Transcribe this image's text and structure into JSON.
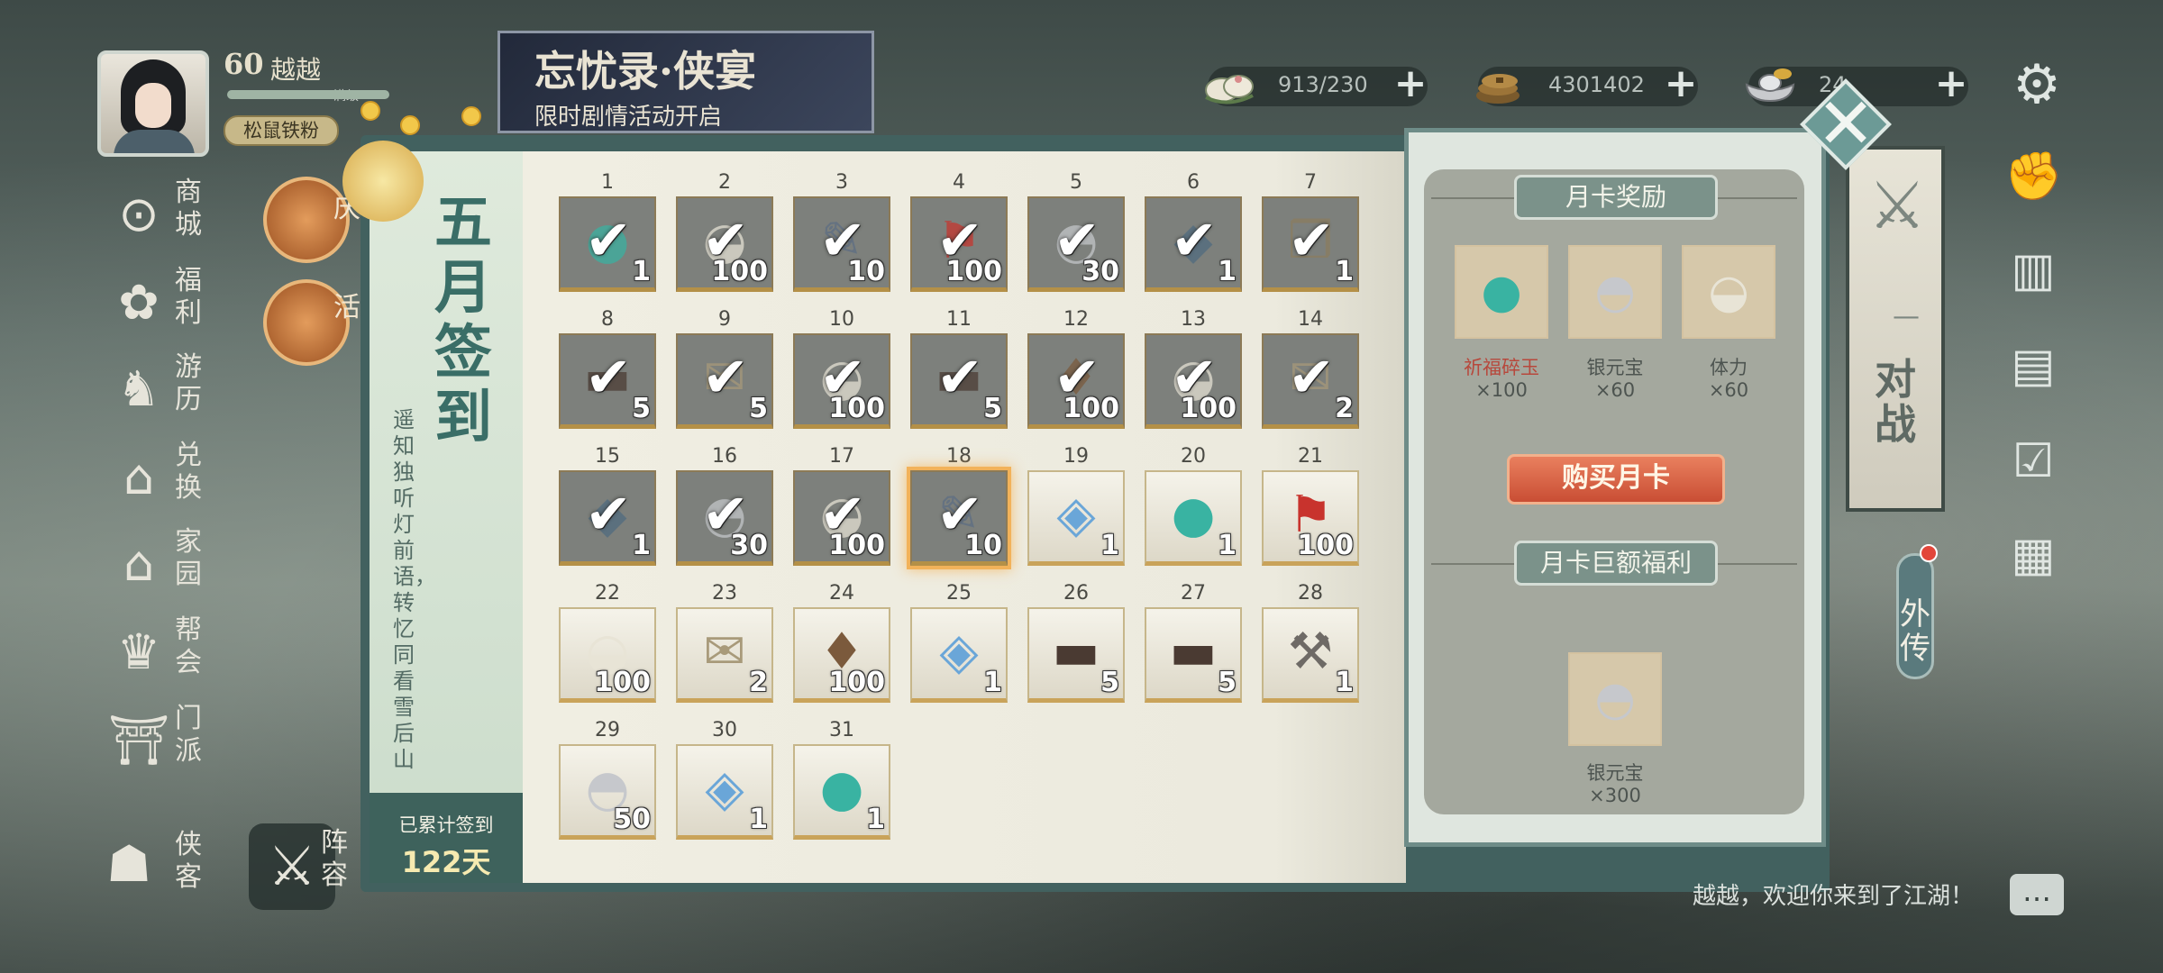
{
  "player": {
    "level": "60",
    "name": "越越",
    "level_caption": "满级",
    "tag": "松鼠铁粉"
  },
  "banner": {
    "title": "忘忧录·侠宴",
    "subtitle": "限时剧情活动开启"
  },
  "resources": [
    {
      "icon": "stamina-bun-icon",
      "value": "913/230",
      "plus": "+"
    },
    {
      "icon": "copper-coins-icon",
      "value": "4301402",
      "plus": "+"
    },
    {
      "icon": "silver-ingot-icon",
      "value": "24",
      "plus": "+"
    }
  ],
  "left_nav": [
    {
      "key": "shop",
      "icon": "coin-shop-icon",
      "glyph": "⊙",
      "label": "商城"
    },
    {
      "key": "welfare",
      "icon": "lotus-icon",
      "glyph": "✿",
      "label": "福利"
    },
    {
      "key": "travel",
      "icon": "horse-icon",
      "glyph": "♞",
      "label": "游历"
    },
    {
      "key": "exchange",
      "icon": "exchange-pavilion-icon",
      "glyph": "⌂",
      "label": "兑换"
    },
    {
      "key": "home",
      "icon": "house-icon",
      "glyph": "⌂",
      "label": "家园"
    },
    {
      "key": "guild",
      "icon": "guild-crest-icon",
      "glyph": "♛",
      "label": "帮会"
    },
    {
      "key": "sect",
      "icon": "sect-gate-icon",
      "glyph": "⛩",
      "label": "门派"
    }
  ],
  "bottom_nav": {
    "hero_label": "侠客",
    "lineup_label": "阵容"
  },
  "side_event_partial": {
    "a": "庆",
    "b": "活"
  },
  "right_nav": [
    "fist-icon",
    "scroll-book-icon",
    "bookshelf-icon",
    "checklist-icon",
    "open-book-icon"
  ],
  "pvp": {
    "label": "对战",
    "divider": "—"
  },
  "outer_story": {
    "label": "外传"
  },
  "signin": {
    "title": "五月签到",
    "poem": "遥知独听灯前语，转忆同看雪后山",
    "total_label": "已累计签到",
    "total_value": "122天",
    "today": 18,
    "days": [
      {
        "day": 1,
        "item": "orb",
        "qty": "1",
        "claimed": true
      },
      {
        "day": 2,
        "item": "bun",
        "qty": "100",
        "claimed": true
      },
      {
        "day": 3,
        "item": "scroll",
        "qty": "10",
        "claimed": true
      },
      {
        "day": 4,
        "item": "banner",
        "qty": "100",
        "claimed": true
      },
      {
        "day": 5,
        "item": "ingot",
        "qty": "30",
        "claimed": true
      },
      {
        "day": 6,
        "item": "stone",
        "qty": "1",
        "claimed": true
      },
      {
        "day": 7,
        "item": "book",
        "qty": "1",
        "claimed": true
      },
      {
        "day": 8,
        "item": "chest",
        "qty": "5",
        "claimed": true
      },
      {
        "day": 9,
        "item": "letters",
        "qty": "5",
        "claimed": true
      },
      {
        "day": 10,
        "item": "bun",
        "qty": "100",
        "claimed": true
      },
      {
        "day": 11,
        "item": "chest",
        "qty": "5",
        "claimed": true
      },
      {
        "day": 12,
        "item": "pouch",
        "qty": "100",
        "claimed": true
      },
      {
        "day": 13,
        "item": "bun",
        "qty": "100",
        "claimed": true
      },
      {
        "day": 14,
        "item": "letters",
        "qty": "2",
        "claimed": true
      },
      {
        "day": 15,
        "item": "stone",
        "qty": "1",
        "claimed": true
      },
      {
        "day": 16,
        "item": "ingot",
        "qty": "30",
        "claimed": true
      },
      {
        "day": 17,
        "item": "bun",
        "qty": "100",
        "claimed": true
      },
      {
        "day": 18,
        "item": "scroll",
        "qty": "10",
        "claimed": true
      },
      {
        "day": 19,
        "item": "crystal",
        "qty": "1",
        "claimed": false
      },
      {
        "day": 20,
        "item": "orb",
        "qty": "1",
        "claimed": false
      },
      {
        "day": 21,
        "item": "banner",
        "qty": "100",
        "claimed": false
      },
      {
        "day": 22,
        "item": "bun",
        "qty": "100",
        "claimed": false
      },
      {
        "day": 23,
        "item": "letters",
        "qty": "2",
        "claimed": false
      },
      {
        "day": 24,
        "item": "pouch",
        "qty": "100",
        "claimed": false
      },
      {
        "day": 25,
        "item": "crystal",
        "qty": "1",
        "claimed": false
      },
      {
        "day": 26,
        "item": "chest",
        "qty": "5",
        "claimed": false
      },
      {
        "day": 27,
        "item": "chest",
        "qty": "5",
        "claimed": false
      },
      {
        "day": 28,
        "item": "hammer",
        "qty": "1",
        "claimed": false
      },
      {
        "day": 29,
        "item": "ingot",
        "qty": "50",
        "claimed": false
      },
      {
        "day": 30,
        "item": "crystal",
        "qty": "1",
        "claimed": false
      },
      {
        "day": 31,
        "item": "orb",
        "qty": "1",
        "claimed": false
      }
    ]
  },
  "item_glyphs": {
    "orb": "●",
    "bun": "◒",
    "scroll": "✎",
    "banner": "⚑",
    "ingot": "◓",
    "stone": "◆",
    "book": "❒",
    "chest": "▬",
    "letters": "✉",
    "pouch": "♦",
    "crystal": "◈",
    "hammer": "⚒"
  },
  "item_colors": {
    "orb": "#39b3a2",
    "bun": "#e8e4d6",
    "scroll": "#5d6e84",
    "banner": "#c8332d",
    "ingot": "#c6c8cc",
    "stone": "#4f6b80",
    "book": "#8c7d5e",
    "chest": "#4a3a32",
    "letters": "#a89a7a",
    "pouch": "#7b5a3c",
    "crystal": "#6aa6d8",
    "hammer": "#6e6a66"
  },
  "month_card": {
    "reward_title": "月卡奖励",
    "rewards": [
      {
        "item": "orb",
        "name": "祈福碎玉",
        "qty": "×100",
        "name_color": "#b7483c"
      },
      {
        "item": "ingot",
        "name": "银元宝",
        "qty": "×60",
        "name_color": "#4d5450"
      },
      {
        "item": "bun",
        "name": "体力",
        "qty": "×60",
        "name_color": "#4d5450"
      }
    ],
    "buy_label": "购买月卡",
    "bonus_title": "月卡巨额福利",
    "bonus": {
      "item": "ingot",
      "name": "银元宝",
      "qty": "×300"
    }
  },
  "close_label": "✕",
  "welcome": "越越，欢迎你来到了江湖！",
  "chat_icon": "…"
}
